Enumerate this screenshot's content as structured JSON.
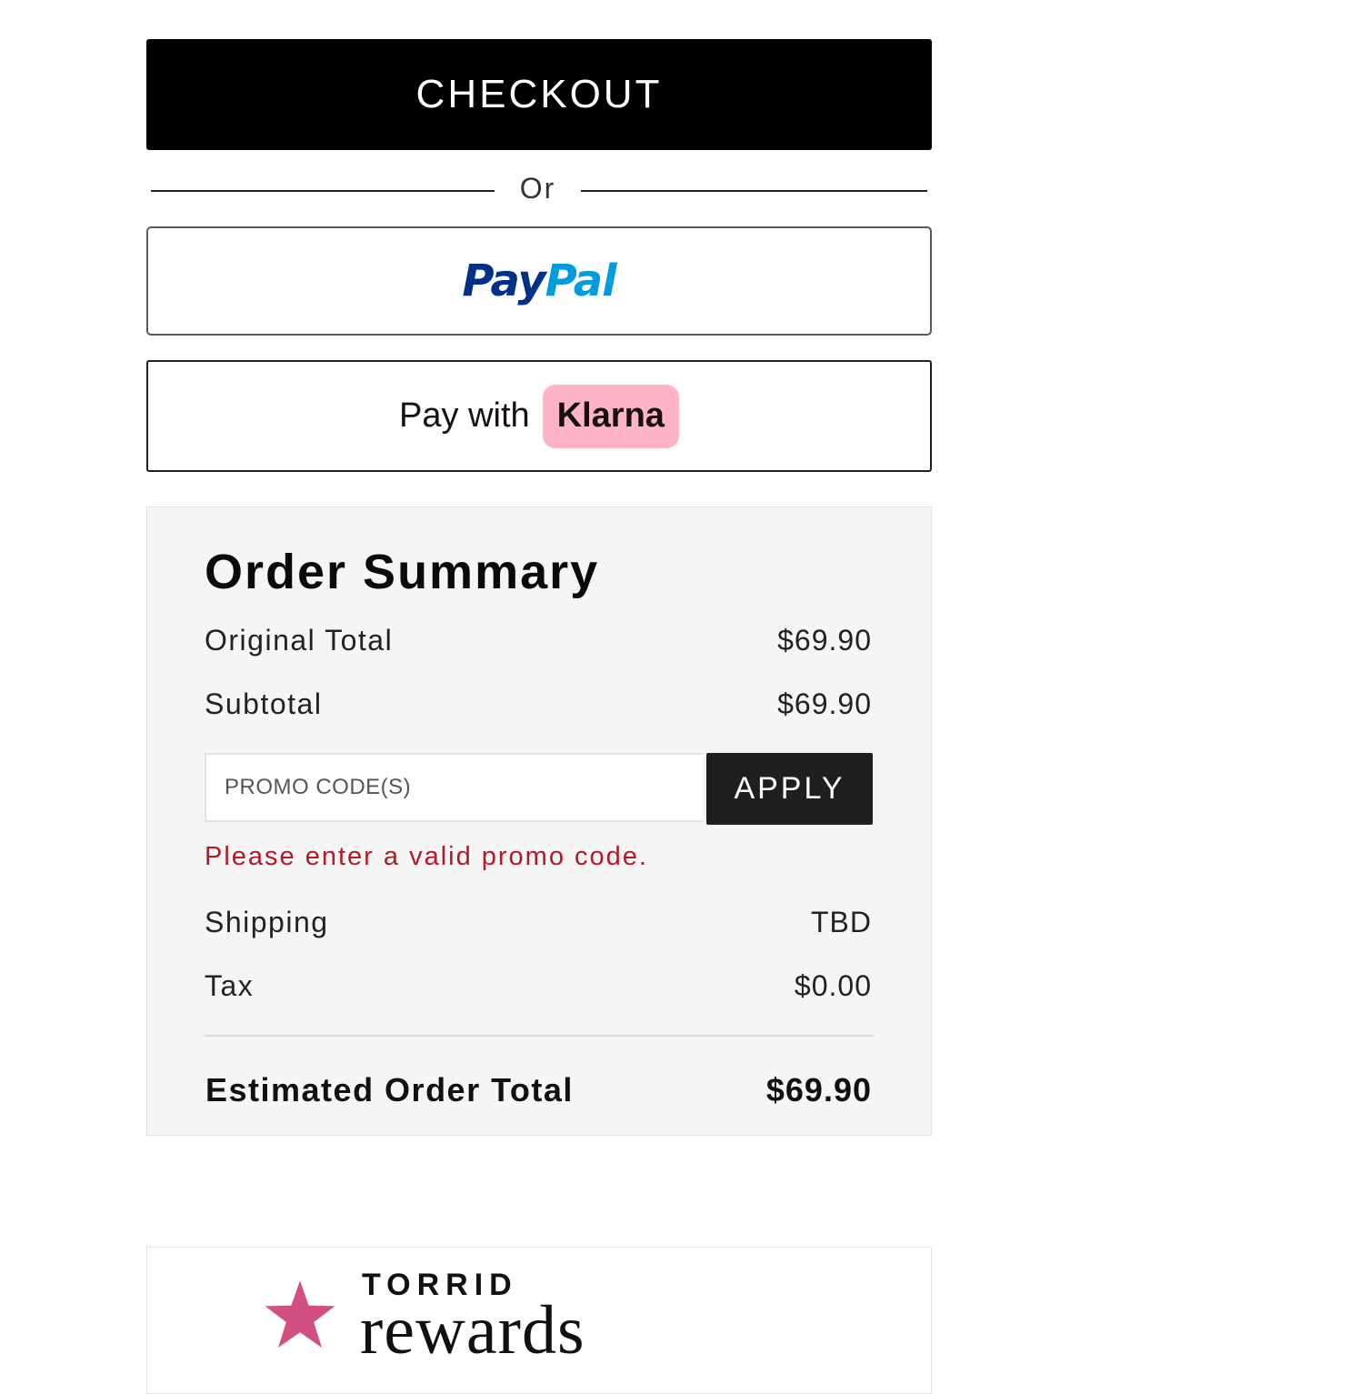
{
  "checkout": {
    "label": "CHECKOUT"
  },
  "divider": {
    "label": "Or"
  },
  "paypal": {
    "pay": "Pay",
    "pal": "Pal",
    "colors": {
      "pay": "#003087",
      "pal": "#009cde"
    }
  },
  "klarna": {
    "prefix": "Pay with",
    "brand": "Klarna",
    "badge_color": "#ffb3c7"
  },
  "summary": {
    "title": "Order Summary",
    "original_total": {
      "label": "Original Total",
      "value": "$69.90"
    },
    "subtotal": {
      "label": "Subtotal",
      "value": "$69.90"
    },
    "promo": {
      "placeholder": "PROMO CODE(S)",
      "value": "",
      "apply_label": "APPLY",
      "error": "Please enter a valid promo code.",
      "error_color": "#b3192b"
    },
    "shipping": {
      "label": "Shipping",
      "value": "TBD"
    },
    "tax": {
      "label": "Tax",
      "value": "$0.00"
    },
    "estimated_total": {
      "label": "Estimated Order Total",
      "value": "$69.90"
    }
  },
  "rewards": {
    "brand_top": "TORRID",
    "brand_bottom": "rewards",
    "star_icon": "star-icon",
    "star_color": "#d2507f"
  }
}
